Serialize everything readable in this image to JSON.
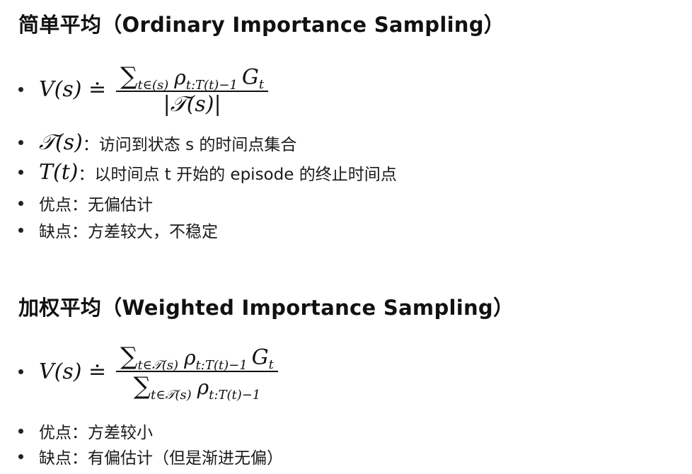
{
  "ordinary": {
    "title": "简单平均（Ordinary Importance Sampling）",
    "formula": {
      "lhs": "V(s) ≐",
      "num_sum": "∑",
      "num_sub": "t∈(s)",
      "num_rho": "ρ",
      "num_rho_sub": "t:T(t)−1",
      "num_g": "G",
      "num_g_sub": "t",
      "den": "|𝒯(s)|"
    },
    "items": [
      {
        "math": "𝒯(s)",
        "text": "：访问到状态 s 的时间点集合"
      },
      {
        "math": "T(t)",
        "text": "：以时间点 t 开始的 episode 的终止时间点"
      },
      {
        "text": "优点：无偏估计"
      },
      {
        "text": "缺点：方差较大，不稳定"
      }
    ]
  },
  "weighted": {
    "title": "加权平均（Weighted Importance Sampling）",
    "formula": {
      "lhs": "V(s) ≐",
      "num_sum": "∑",
      "num_sub": "t∈𝒯(s)",
      "num_rho": "ρ",
      "num_rho_sub": "t:T(t)−1",
      "num_g": "G",
      "num_g_sub": "t",
      "den_sum": "∑",
      "den_sub": "t∈𝒯(s)",
      "den_rho": "ρ",
      "den_rho_sub": "t:T(t)−1"
    },
    "items": [
      {
        "text": "优点：方差较小"
      },
      {
        "text": "缺点：有偏估计（但是渐进无偏）"
      }
    ]
  }
}
